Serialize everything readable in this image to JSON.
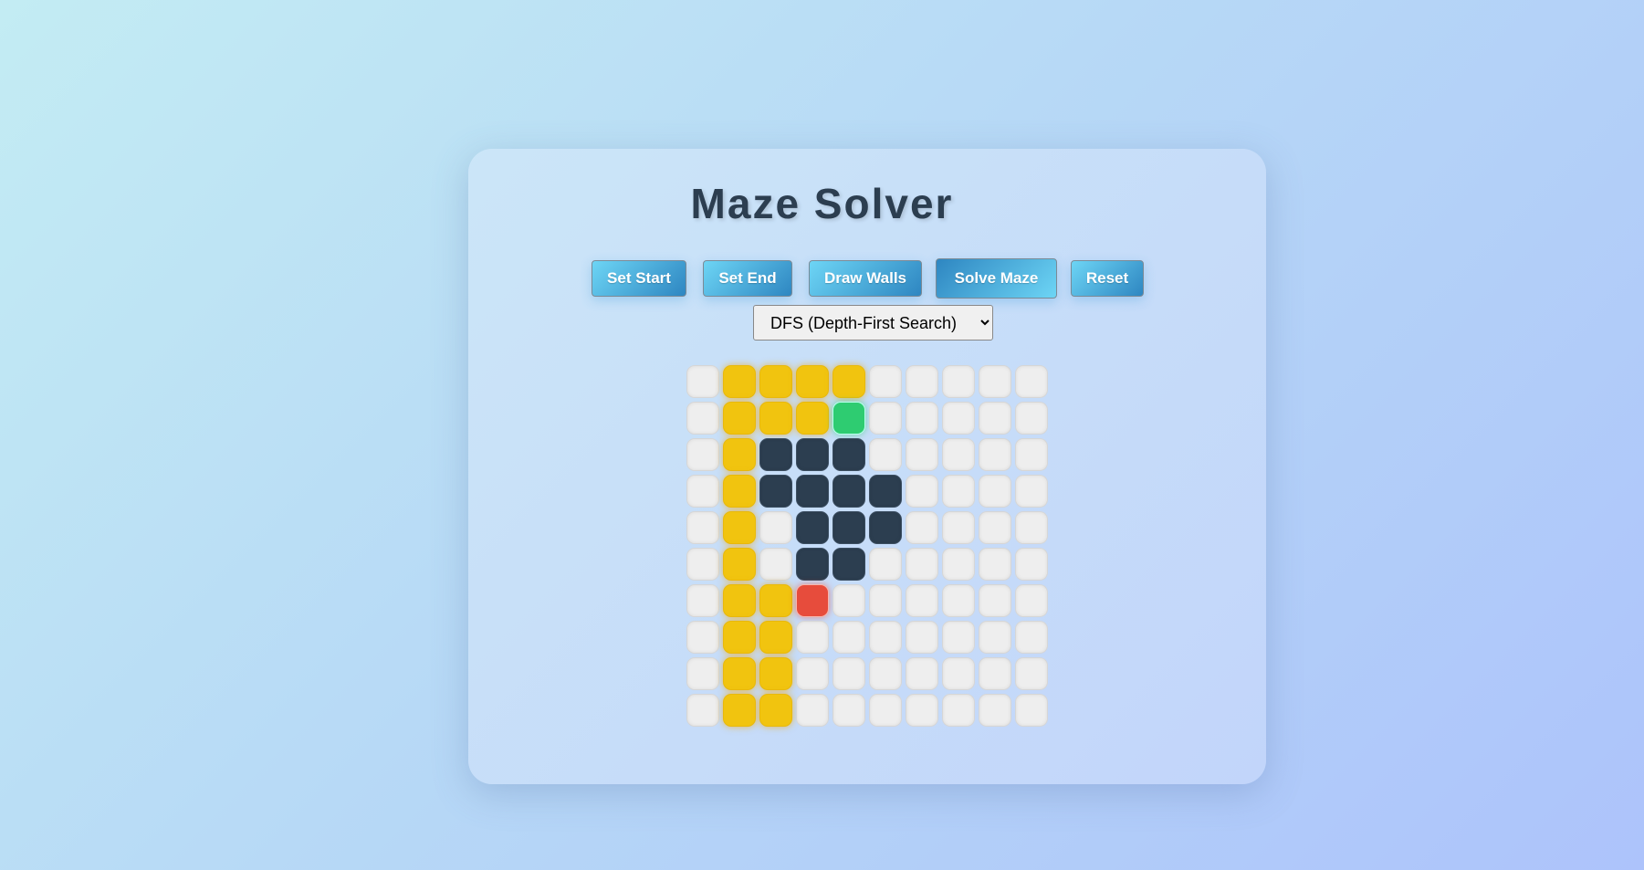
{
  "title": "Maze Solver",
  "buttons": {
    "set_start": "Set Start",
    "set_end": "Set End",
    "draw_walls": "Draw Walls",
    "solve_maze": "Solve Maze",
    "reset": "Reset"
  },
  "algorithm": {
    "selected": "DFS (Depth-First Search)"
  },
  "colors": {
    "start": "#2ecc71",
    "end": "#e74c3c",
    "wall": "#2c3e50",
    "path": "#f1c40f",
    "empty": "#eeeeee"
  },
  "maze": {
    "legend": {
      "S": "start",
      "E": "end",
      "W": "wall",
      "P": "path",
      ".": "empty"
    },
    "rows": [
      ".PPPP.....",
      ".PPPS.....",
      ".PWWW.....",
      ".PWWWW....",
      ".P.WWW....",
      ".P.WW.....",
      ".PPE......",
      ".PP.......",
      ".PP.......",
      ".PP......."
    ]
  }
}
